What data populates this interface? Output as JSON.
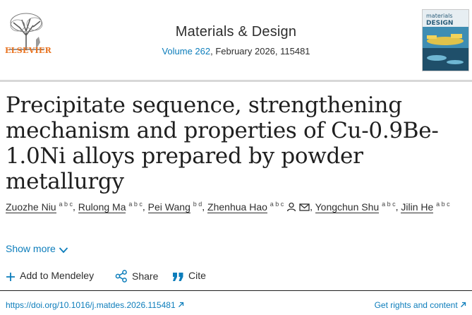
{
  "header": {
    "publisher": "ELSEVIER",
    "journal_title": "Materials & Design",
    "volume_link": "Volume 262",
    "issue_info": ", February 2026, 115481",
    "cover_title_line1": "materials",
    "cover_title_line2": "DESIGN"
  },
  "article": {
    "title": "Precipitate sequence, strengthening mechanism and properties of Cu-0.9Be-1.0Ni alloys prepared by powder metallurgy"
  },
  "authors": [
    {
      "name": "Zuozhe Niu",
      "affil": "a b c"
    },
    {
      "name": "Rulong Ma",
      "affil": "a b c"
    },
    {
      "name": "Pei Wang",
      "affil": "b d"
    },
    {
      "name": "Zhenhua Hao",
      "affil": "a b c"
    },
    {
      "name": "Yongchun Shu",
      "affil": "a b c"
    },
    {
      "name": "Jilin He",
      "affil": "a b c"
    }
  ],
  "show_more": "Show more",
  "actions": {
    "mendeley": "Add to Mendeley",
    "share": "Share",
    "cite": "Cite"
  },
  "footer": {
    "doi": "https://doi.org/10.1016/j.matdes.2026.115481",
    "rights": "Get rights and content"
  },
  "colors": {
    "link": "#0c7dbb",
    "publisher_orange": "#e9711c",
    "text": "#1f1f1f"
  }
}
